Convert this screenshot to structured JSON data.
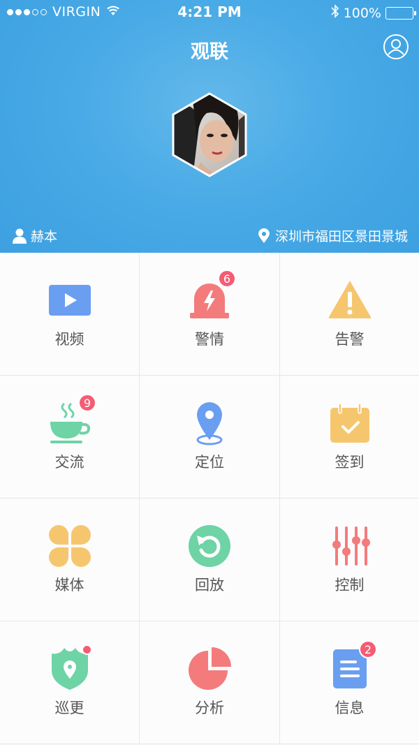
{
  "status_bar": {
    "carrier": "VIRGIN",
    "time": "4:21 PM",
    "battery": "100%"
  },
  "header": {
    "title": "观联"
  },
  "user": {
    "name": "赫本"
  },
  "location": {
    "text": "深圳市福田区景田景城"
  },
  "colors": {
    "header_blue": "#3ea3e3",
    "badge_red": "#f35d74"
  },
  "menu": [
    {
      "label": "视频",
      "icon": "video-play-icon"
    },
    {
      "label": "警情",
      "icon": "alarm-siren-icon",
      "badge": "6"
    },
    {
      "label": "告警",
      "icon": "warning-triangle-icon"
    },
    {
      "label": "交流",
      "icon": "coffee-cup-icon",
      "badge": "9"
    },
    {
      "label": "定位",
      "icon": "location-pin-icon"
    },
    {
      "label": "签到",
      "icon": "calendar-check-icon"
    },
    {
      "label": "媒体",
      "icon": "clover-grid-icon"
    },
    {
      "label": "回放",
      "icon": "replay-icon"
    },
    {
      "label": "控制",
      "icon": "sliders-icon"
    },
    {
      "label": "巡更",
      "icon": "shield-pin-icon",
      "dot": true
    },
    {
      "label": "分析",
      "icon": "pie-chart-icon"
    },
    {
      "label": "信息",
      "icon": "document-list-icon",
      "badge": "2"
    }
  ]
}
